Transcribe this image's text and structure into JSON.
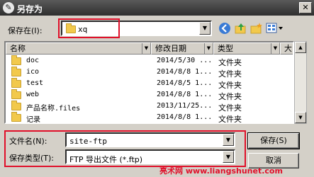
{
  "window": {
    "title": "另存为",
    "close_glyph": "✕"
  },
  "save_in": {
    "label": "保存在(I):",
    "value": "xq"
  },
  "toolbar": {
    "icons": [
      "back-icon",
      "up-folder-icon",
      "new-folder-icon",
      "view-menu-icon"
    ]
  },
  "columns": [
    "名称",
    "修改日期",
    "类型",
    "大"
  ],
  "files": [
    {
      "name": "doc",
      "date": "2014/5/30 ...",
      "type": "文件夹"
    },
    {
      "name": "ico",
      "date": "2014/8/8 1...",
      "type": "文件夹"
    },
    {
      "name": "test",
      "date": "2014/8/5 1...",
      "type": "文件夹"
    },
    {
      "name": "web",
      "date": "2014/8/8 1...",
      "type": "文件夹"
    },
    {
      "name": "产品名称.files",
      "date": "2013/11/25...",
      "type": "文件夹"
    },
    {
      "name": "记录",
      "date": "2014/8/8 1...",
      "type": "文件夹"
    }
  ],
  "filename": {
    "label": "文件名(N):",
    "value": "site-ftp"
  },
  "filetype": {
    "label": "保存类型(T):",
    "value": "FTP 导出文件 (*.ftp)"
  },
  "buttons": {
    "save": "保存(S)",
    "cancel": "取消"
  },
  "watermark": "亮术网 www.liangshunet.com",
  "colors": {
    "highlight": "#e0102a",
    "titlebar": "#3a3a3a",
    "folder": "#f2c94c"
  }
}
